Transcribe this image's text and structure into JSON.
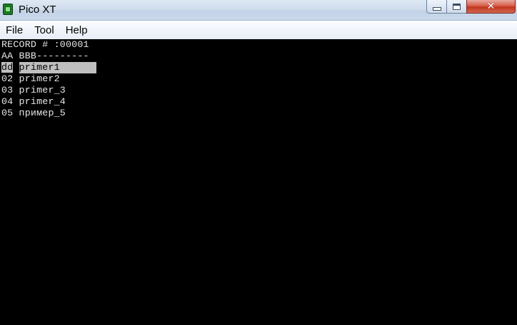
{
  "window": {
    "title": "Pico XT",
    "icon": "pico-app-icon",
    "controls": {
      "minimize": "minimize-icon",
      "maximize": "maximize-icon",
      "close_symbol": "✕"
    }
  },
  "menu": {
    "items": [
      "File",
      "Tool",
      "Help"
    ]
  },
  "console": {
    "header": "RECORD # :00001",
    "columns_line": "AA BBB---------",
    "rows": [
      {
        "code": "dd",
        "name": "primer1",
        "selected": true
      },
      {
        "code": "02",
        "name": "primer2",
        "selected": false
      },
      {
        "code": "03",
        "name": "primer_3",
        "selected": false
      },
      {
        "code": "04",
        "name": "primer_4",
        "selected": false
      },
      {
        "code": "05",
        "name": "пример_5",
        "selected": false
      }
    ],
    "colors": {
      "background": "#000000",
      "text": "#e6e6e6",
      "highlight": "#bfbfbf"
    }
  }
}
